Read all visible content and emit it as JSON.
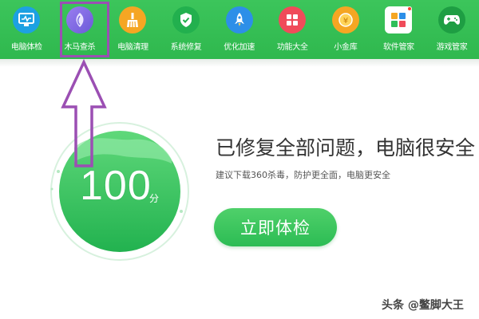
{
  "toolbar": {
    "items": [
      {
        "label": "电脑体检",
        "icon": "monitor-check-icon",
        "color": "#1da1e2"
      },
      {
        "label": "木马查杀",
        "icon": "shield-leaf-icon",
        "color": "#7b6ee0"
      },
      {
        "label": "电脑清理",
        "icon": "broom-icon",
        "color": "#f5a623"
      },
      {
        "label": "系统修复",
        "icon": "shield-check-icon",
        "color": "#2fbf5a"
      },
      {
        "label": "优化加速",
        "icon": "rocket-icon",
        "color": "#2d8fe8"
      },
      {
        "label": "功能大全",
        "icon": "grid-icon",
        "color": "#f04b5a"
      },
      {
        "label": "小金库",
        "icon": "coin-icon",
        "color": "#f5a623"
      },
      {
        "label": "软件管家",
        "icon": "apps-icon",
        "color": "#ffffff"
      },
      {
        "label": "游戏管家",
        "icon": "gamepad-icon",
        "color": "#ffffff"
      }
    ]
  },
  "score": {
    "value": "100",
    "unit": "分"
  },
  "status": {
    "headline": "已修复全部问题，电脑很安全",
    "subline": "建议下载360杀毒，防护更全面，电脑更安全"
  },
  "actions": {
    "check_label": "立即体检"
  },
  "watermark": "头条 @鳖脚大王",
  "colors": {
    "toolbar_green": "#35be53",
    "annotation_purple": "#9b4fb3",
    "button_green": "#34c45a"
  }
}
